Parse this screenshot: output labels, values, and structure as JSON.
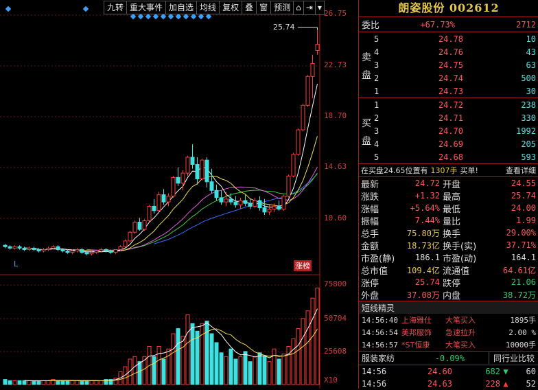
{
  "toolbar": {
    "items": [
      "九转",
      "重大事件",
      "加自选",
      "均线",
      "复权",
      "叠",
      "窗",
      "预测"
    ],
    "icons": [
      "lock-icon",
      "collapse-icon",
      "dropdown-icon"
    ]
  },
  "chart": {
    "price_axis": [
      "26.75",
      "22.73",
      "18.70",
      "14.63",
      "10.60"
    ],
    "vol_axis": [
      "75800",
      "50704",
      "25608",
      "X10"
    ],
    "high_label": "25.74",
    "left_marker": "L",
    "zhangbang_label": "涨榜",
    "colors": {
      "up": "#ff3c3c",
      "down": "#3fe0e0",
      "ma5": "#ffffff",
      "ma10": "#f0e050",
      "ma20": "#e060e0",
      "ma30": "#40d040",
      "ma60": "#3070ff"
    }
  },
  "chart_data": {
    "type": "candlestick",
    "candles": [
      [
        10.8,
        10.9,
        10.6,
        10.7
      ],
      [
        10.7,
        10.8,
        10.5,
        10.6
      ],
      [
        10.6,
        10.8,
        10.5,
        10.7
      ],
      [
        10.7,
        10.8,
        10.5,
        10.6
      ],
      [
        10.6,
        10.7,
        10.4,
        10.5
      ],
      [
        10.5,
        10.7,
        10.4,
        10.6
      ],
      [
        10.6,
        10.7,
        10.4,
        10.5
      ],
      [
        10.5,
        10.6,
        10.3,
        10.4
      ],
      [
        10.4,
        10.6,
        10.3,
        10.5
      ],
      [
        10.5,
        10.7,
        10.4,
        10.6
      ],
      [
        10.6,
        10.8,
        10.5,
        10.7
      ],
      [
        10.7,
        10.8,
        10.4,
        10.5
      ],
      [
        10.5,
        10.6,
        10.3,
        10.4
      ],
      [
        10.4,
        10.5,
        10.2,
        10.3
      ],
      [
        10.3,
        10.5,
        10.2,
        10.4
      ],
      [
        10.4,
        10.6,
        10.3,
        10.5
      ],
      [
        10.5,
        10.6,
        10.2,
        10.3
      ],
      [
        10.3,
        10.4,
        10.1,
        10.2
      ],
      [
        10.2,
        10.4,
        10.1,
        10.3
      ],
      [
        10.3,
        10.5,
        10.2,
        10.4
      ],
      [
        10.4,
        10.6,
        10.3,
        10.5
      ],
      [
        10.5,
        10.6,
        10.3,
        10.4
      ],
      [
        10.4,
        10.5,
        10.2,
        10.3
      ],
      [
        10.3,
        10.5,
        10.2,
        10.5
      ],
      [
        10.5,
        10.8,
        10.4,
        10.7
      ],
      [
        10.7,
        11.2,
        10.6,
        11.1
      ],
      [
        11.1,
        11.8,
        11.0,
        11.7
      ],
      [
        11.7,
        12.5,
        11.6,
        12.4
      ],
      [
        12.4,
        12.7,
        11.8,
        11.9
      ],
      [
        11.9,
        12.6,
        11.8,
        12.5
      ],
      [
        12.5,
        13.6,
        12.4,
        13.5
      ],
      [
        13.5,
        14.0,
        13.0,
        13.2
      ],
      [
        13.2,
        14.5,
        13.1,
        14.3
      ],
      [
        14.3,
        14.7,
        13.6,
        13.8
      ],
      [
        13.8,
        14.4,
        13.5,
        14.2
      ],
      [
        14.2,
        15.6,
        14.1,
        15.5
      ],
      [
        15.5,
        16.2,
        14.9,
        15.1
      ],
      [
        15.1,
        16.0,
        14.6,
        15.8
      ],
      [
        15.8,
        17.0,
        15.6,
        16.9
      ],
      [
        16.9,
        17.8,
        16.1,
        16.4
      ],
      [
        16.4,
        16.9,
        15.0,
        15.4
      ],
      [
        15.4,
        16.8,
        15.3,
        16.7
      ],
      [
        16.7,
        16.9,
        14.8,
        15.2
      ],
      [
        15.2,
        16.1,
        14.4,
        14.6
      ],
      [
        14.6,
        15.0,
        13.9,
        14.1
      ],
      [
        14.1,
        14.6,
        13.6,
        13.8
      ],
      [
        13.8,
        14.5,
        13.5,
        14.0
      ],
      [
        14.0,
        14.4,
        13.6,
        13.8
      ],
      [
        13.8,
        14.2,
        13.4,
        13.6
      ],
      [
        13.6,
        14.1,
        13.3,
        13.9
      ],
      [
        13.9,
        14.3,
        13.5,
        13.7
      ],
      [
        13.7,
        14.0,
        13.3,
        13.5
      ],
      [
        13.5,
        14.1,
        13.4,
        13.9
      ],
      [
        13.9,
        14.2,
        13.2,
        13.4
      ],
      [
        13.4,
        14.0,
        12.9,
        13.1
      ],
      [
        13.1,
        13.6,
        12.9,
        13.3
      ],
      [
        13.3,
        13.7,
        13.1,
        13.5
      ],
      [
        13.5,
        13.9,
        13.2,
        13.3
      ],
      [
        13.3,
        14.3,
        13.2,
        14.2
      ],
      [
        14.2,
        15.7,
        14.1,
        15.6
      ],
      [
        15.6,
        17.2,
        15.5,
        17.1
      ],
      [
        17.1,
        18.9,
        17.0,
        18.8
      ],
      [
        18.8,
        20.6,
        18.7,
        20.5
      ],
      [
        20.5,
        22.6,
        20.4,
        22.5
      ],
      [
        22.5,
        24.0,
        21.0,
        23.4
      ],
      [
        24.3,
        25.74,
        24.0,
        24.72
      ]
    ],
    "volumes": [
      4,
      3,
      3,
      3,
      3,
      3,
      3,
      3,
      3,
      3,
      4,
      3,
      3,
      3,
      3,
      3,
      3,
      3,
      3,
      3,
      3,
      4,
      4,
      5,
      10,
      14,
      20,
      22,
      18,
      22,
      30,
      22,
      30,
      20,
      28,
      40,
      44,
      38,
      55,
      48,
      42,
      48,
      50,
      40,
      33,
      25,
      22,
      28,
      20,
      22,
      26,
      18,
      22,
      25,
      22,
      18,
      28,
      20,
      24,
      30,
      36,
      44,
      52,
      58,
      68,
      76
    ],
    "ylim": [
      9.0,
      26.75
    ],
    "vol_ylim": [
      0,
      80000
    ]
  },
  "header": {
    "title": "朗姿股份 002612"
  },
  "weibi": {
    "label": "委比",
    "value": "+67.73%",
    "diff": "2712"
  },
  "sell": [
    {
      "lv": "5",
      "price": "24.78",
      "vol": "10"
    },
    {
      "lv": "4",
      "price": "24.76",
      "vol": "43"
    },
    {
      "lv": "3",
      "price": "24.75",
      "vol": "63"
    },
    {
      "lv": "2",
      "price": "24.74",
      "vol": "500"
    },
    {
      "lv": "1",
      "price": "24.73",
      "vol": "30"
    }
  ],
  "buy": [
    {
      "lv": "1",
      "price": "24.72",
      "vol": "238"
    },
    {
      "lv": "2",
      "price": "24.71",
      "vol": "330"
    },
    {
      "lv": "3",
      "price": "24.70",
      "vol": "1992"
    },
    {
      "lv": "4",
      "price": "24.69",
      "vol": "205"
    },
    {
      "lv": "5",
      "price": "24.68",
      "vol": "593"
    }
  ],
  "sell_side_label": [
    "卖",
    "盘"
  ],
  "buy_side_label": [
    "买",
    "盘"
  ],
  "order_note": {
    "text": "在买盘24.65位置有",
    "qty": "1307手",
    "buy": "买单!",
    "detail": "查看详细"
  },
  "stats": [
    {
      "k1": "最新",
      "v1": "24.72",
      "c1": "r",
      "k2": "开盘",
      "v2": "24.55",
      "c2": "r"
    },
    {
      "k1": "涨跌",
      "v1": "+1.32",
      "c1": "r",
      "k2": "最高",
      "v2": "25.74",
      "c2": "r"
    },
    {
      "k1": "涨幅",
      "v1": "+5.64%",
      "c1": "r",
      "k2": "最低",
      "v2": "24.00",
      "c2": "r"
    },
    {
      "k1": "振幅",
      "v1": "7.44%",
      "c1": "r",
      "k2": "量比",
      "v2": "1.99",
      "c2": "r"
    },
    {
      "k1": "总手",
      "v1": "75.80万",
      "c1": "y",
      "k2": "换手",
      "v2": "29.00%",
      "c2": "y"
    },
    {
      "k1": "金额",
      "v1": "18.73亿",
      "c1": "y",
      "k2": "换手(实)",
      "v2": "37.71%",
      "c2": "y"
    },
    {
      "k1": "市盈(静)",
      "v1": "186.1",
      "c1": "w",
      "k2": "市盈(动)",
      "v2": "164.1",
      "c2": "w"
    },
    {
      "k1": "总市值",
      "v1": "109.4亿",
      "c1": "y",
      "k2": "流通值",
      "v2": "64.61亿",
      "c2": "y"
    },
    {
      "k1": "涨停",
      "v1": "25.74",
      "c1": "r",
      "k2": "跌停",
      "v2": "21.06",
      "c2": "g"
    },
    {
      "k1": "外盘",
      "v1": "37.08万",
      "c1": "r",
      "k2": "内盘",
      "v2": "38.72万",
      "c2": "g"
    }
  ],
  "news": {
    "title": "短线精灵",
    "items": [
      {
        "t": "14:56:40",
        "n": "上海雅仕",
        "e": "大笔买入",
        "q": "1895手"
      },
      {
        "t": "14:56:54",
        "n": "美邦服饰",
        "e": "急速拉升",
        "q": "2.00 %"
      },
      {
        "t": "14:56:57",
        "n": "*ST恒康",
        "e": "大笔买入",
        "q": "10000手"
      }
    ]
  },
  "industry": {
    "name": "服装家纺",
    "pct": "-0.09%",
    "compare": "同行业比较"
  },
  "ticks": [
    {
      "t": "14:56",
      "p": "24.60",
      "v": "682",
      "dir": "down",
      "n": "60"
    },
    {
      "t": "14:56",
      "p": "24.63",
      "v": "228",
      "dir": "up",
      "n": "52"
    }
  ]
}
